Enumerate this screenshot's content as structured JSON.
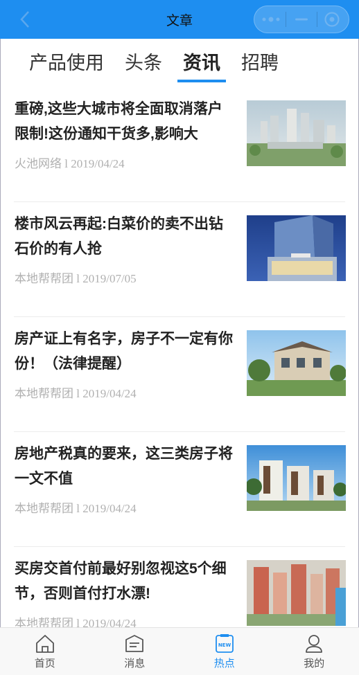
{
  "header": {
    "title": "文章"
  },
  "tabs": [
    {
      "label": "产品使用",
      "active": false
    },
    {
      "label": "头条",
      "active": false
    },
    {
      "label": "资讯",
      "active": true
    },
    {
      "label": "招聘",
      "active": false
    }
  ],
  "articles": [
    {
      "title": "重磅,这些大城市将全面取消落户限制!这份通知干货多,影响大",
      "source": "火池网络",
      "date": "2019/04/24"
    },
    {
      "title": "楼市风云再起:白菜价的卖不出钻石价的有人抢",
      "source": "本地帮帮团",
      "date": "2019/07/05"
    },
    {
      "title": "房产证上有名字，房子不一定有你份！（法律提醒）",
      "source": "本地帮帮团",
      "date": "2019/04/24"
    },
    {
      "title": "房地产税真的要来，这三类房子将一文不值",
      "source": "本地帮帮团",
      "date": "2019/04/24"
    },
    {
      "title": "买房交首付前最好别忽视这5个细节，否则首付打水漂!",
      "source": "本地帮帮团",
      "date": "2019/04/24"
    }
  ],
  "meta_separator": "l",
  "tabbar": [
    {
      "label": "首页",
      "icon": "home-icon"
    },
    {
      "label": "消息",
      "icon": "message-icon"
    },
    {
      "label": "热点",
      "icon": "new-badge-icon",
      "badge": "NEW",
      "active": true
    },
    {
      "label": "我的",
      "icon": "user-icon"
    }
  ],
  "colors": {
    "accent": "#1e8ef0",
    "header_bg": "#1e8ef0",
    "meta_text": "#b0b0b0"
  }
}
